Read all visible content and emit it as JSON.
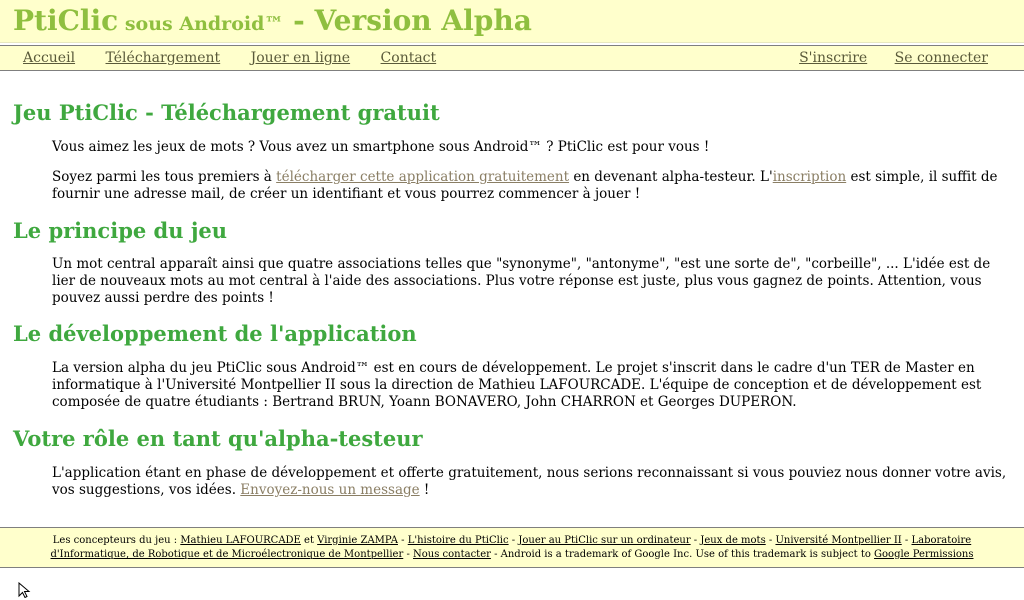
{
  "header": {
    "title_main": "PtiClic",
    "title_small": " sous Android™",
    "title_rest": " - Version Alpha"
  },
  "nav": {
    "left": [
      "Accueil",
      "Téléchargement",
      "Jouer en ligne",
      "Contact"
    ],
    "right": [
      "S'inscrire",
      "Se connecter"
    ]
  },
  "sections": {
    "s1": {
      "title": "Jeu PtiClic - Téléchargement gratuit",
      "p1": "Vous aimez les jeux de mots ? Vous avez un smartphone sous Android™ ? PtiClic est pour vous !",
      "p2_a": "Soyez parmi les tous premiers à ",
      "p2_link1": "télécharger cette application gratuitement",
      "p2_b": " en devenant alpha-testeur. L'",
      "p2_link2": "inscription",
      "p2_c": " est simple, il suffit de fournir une adresse mail, de créer un identifiant et vous pourrez commencer à jouer !"
    },
    "s2": {
      "title": "Le principe du jeu",
      "p1": "Un mot central apparaît ainsi que quatre associations telles que \"synonyme\", \"antonyme\", \"est une sorte de\", \"corbeille\", ... L'idée est de lier de nouveaux mots au mot central à l'aide des associations. Plus votre réponse est juste, plus vous gagnez de points. Attention, vous pouvez aussi perdre des points !"
    },
    "s3": {
      "title": "Le développement de l'application",
      "p1": "La version alpha du jeu PtiClic sous Android™ est en cours de développement. Le projet s'inscrit dans le cadre d'un TER de Master en informatique à l'Université Montpellier II sous la direction de Mathieu LAFOURCADE. L'équipe de conception et de développement est composée de quatre étudiants : Bertrand BRUN, Yoann BONAVERO, John CHARRON et Georges DUPERON."
    },
    "s4": {
      "title": "Votre rôle en tant qu'alpha-testeur",
      "p1_a": "L'application étant en phase de développement et offerte gratuitement, nous serions reconnaissant si vous pouviez nous donner votre avis, vos suggestions, vos idées. ",
      "p1_link": "Envoyez-nous un message",
      "p1_b": " !"
    }
  },
  "footer": {
    "t0": "Les concepteurs du jeu : ",
    "l1": "Mathieu LAFOURCADE",
    "t1": " et ",
    "l2": "Virginie ZAMPA",
    "sep": " - ",
    "l3": "L'histoire du PtiClic",
    "l4": "Jouer au PtiClic sur un ordinateur",
    "l5": "Jeux de mots",
    "l6": "Université Montpellier II",
    "l7": "Laboratoire d'Informatique, de Robotique et de Microélectronique de Montpellier",
    "l8": "Nous contacter",
    "t2": " - Android is a trademark of Google Inc. Use of this trademark is subject to ",
    "l9": "Google Permissions"
  },
  "colors": {
    "title": "#8fbf3f",
    "heading": "#3fa83f",
    "bar_bg": "#ffffcc",
    "link": "#8a7e64"
  },
  "icons": {
    "cursor": "mouse-pointer-icon"
  }
}
